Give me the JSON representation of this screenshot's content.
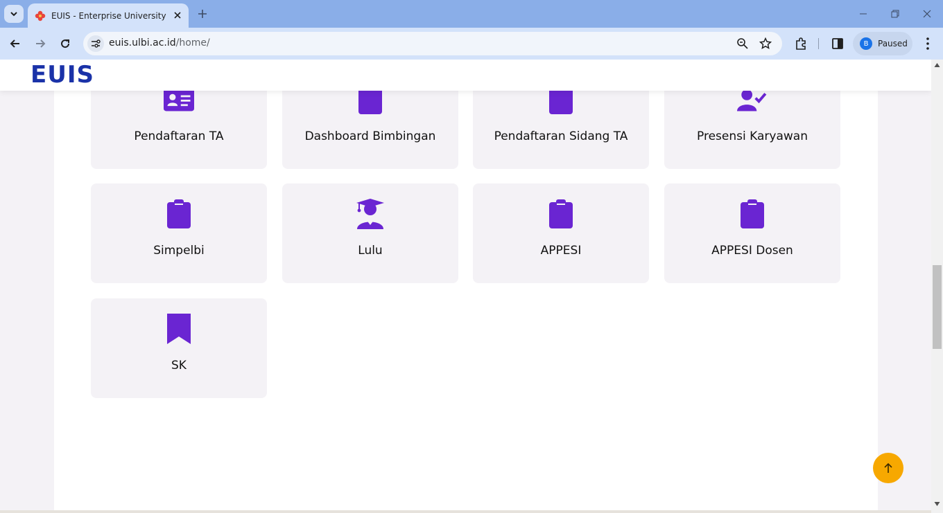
{
  "browser": {
    "tab_title": "EUIS - Enterprise University Information System",
    "url_host": "euis.ulbi.ac.id",
    "url_path": "/home/",
    "profile_initial": "B",
    "profile_status": "Paused"
  },
  "site": {
    "logo": "EUIS",
    "brand_color": "#1a32a8",
    "icon_color": "#6a25d2",
    "scroll_top_color": "#f7a800"
  },
  "menu": {
    "items": [
      {
        "label": "Pendaftaran TA",
        "icon": "id-card-icon"
      },
      {
        "label": "Dashboard Bimbingan",
        "icon": "clipboard-icon"
      },
      {
        "label": "Pendaftaran Sidang TA",
        "icon": "clipboard-icon"
      },
      {
        "label": "Presensi Karyawan",
        "icon": "user-check-icon"
      },
      {
        "label": "Simpelbi",
        "icon": "clipboard-icon"
      },
      {
        "label": "Lulu",
        "icon": "user-graduate-icon"
      },
      {
        "label": "APPESI",
        "icon": "clipboard-icon"
      },
      {
        "label": "APPESI Dosen",
        "icon": "clipboard-icon"
      },
      {
        "label": "SK",
        "icon": "bookmark-icon"
      }
    ]
  }
}
